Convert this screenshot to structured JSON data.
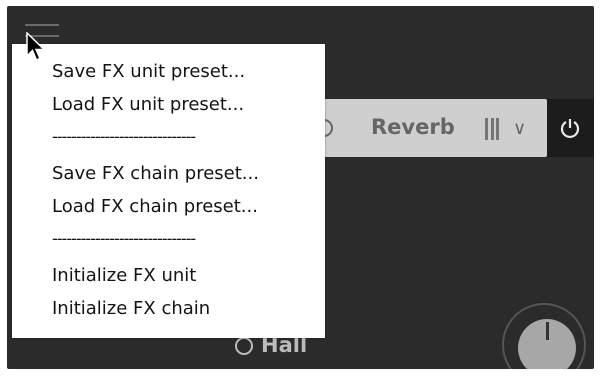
{
  "fx_slot": {
    "name": "Reverb",
    "chevron": "∨",
    "menu_icon": "bars-icon",
    "power_icon": "power-icon"
  },
  "background": {
    "mode_label": "Hall"
  },
  "menu": {
    "items": [
      "Save FX unit preset...",
      "Load FX unit preset...",
      "------------------------------",
      "Save FX chain preset...",
      "Load FX chain preset...",
      "------------------------------",
      "Initialize FX unit",
      "Initialize FX chain"
    ]
  },
  "colors": {
    "panel": "#2b2b2b",
    "slot": "#cfcfcf",
    "menu_bg": "#ffffff"
  }
}
